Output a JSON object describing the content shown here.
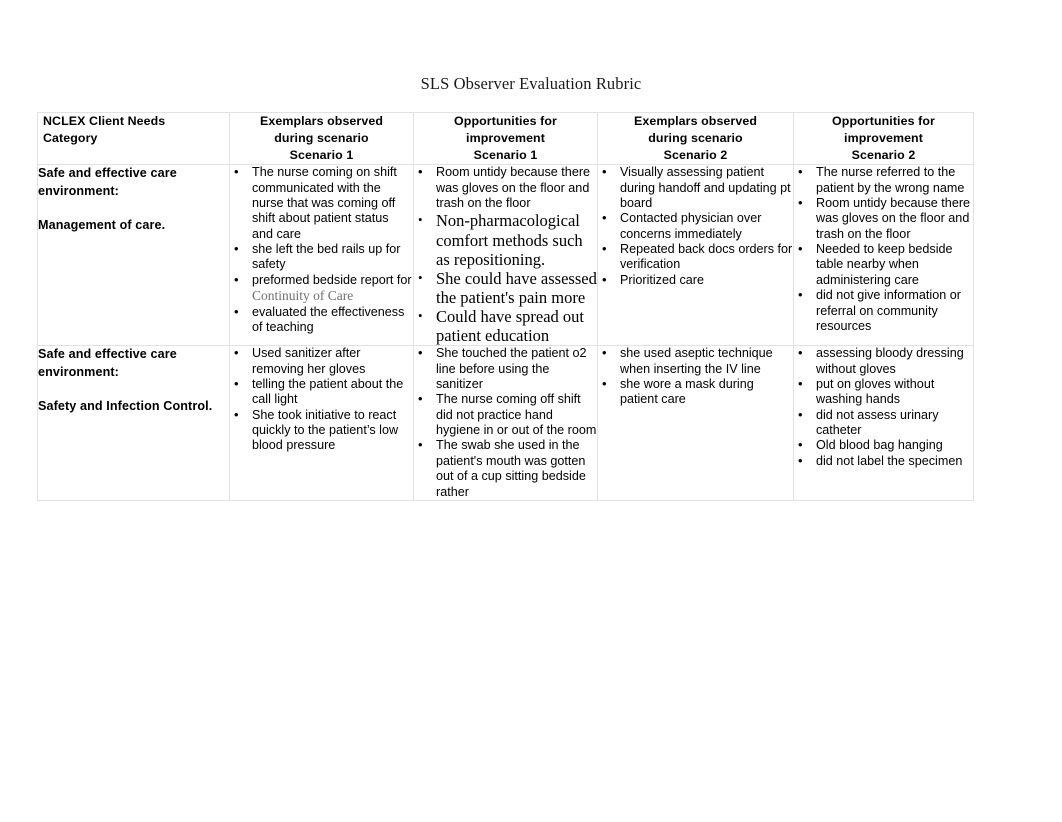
{
  "document": {
    "title": "SLS Observer Evaluation Rubric"
  },
  "table": {
    "headers": [
      "NCLEX Client Needs Category",
      "Exemplars observed during scenario Scenario 1",
      "Opportunities for improvement Scenario 1",
      "Exemplars observed during scenario Scenario 2",
      "Opportunities for improvement Scenario 2"
    ],
    "headers_lines": {
      "col1": [
        "NCLEX Client Needs",
        "Category"
      ],
      "col2": [
        "Exemplars observed",
        "during scenario",
        "Scenario 1"
      ],
      "col3": [
        "Opportunities for",
        "improvement",
        "Scenario 1"
      ],
      "col4": [
        "Exemplars observed",
        "during scenario",
        "Scenario 2"
      ],
      "col5": [
        "Opportunities for",
        "improvement",
        "Scenario 2"
      ]
    },
    "rows": [
      {
        "category": {
          "line1": "Safe and effective care environment:",
          "line2": "Management of care."
        },
        "exemplars_s1": [
          "The nurse coming on shift communicated with the nurse that was coming off shift about patient status and care",
          "she left the bed rails up for safety",
          "preformed bedside report for Continuity of Care",
          "evaluated the effectiveness of teaching"
        ],
        "exemplars_s1_parts": {
          "bullet3_plain": "preformed bedside report for ",
          "bullet3_emphasis": "Continuity of Care"
        },
        "opportunities_s1": [
          "Room untidy because there was gloves on the floor and trash on the floor",
          "Non-pharmacological comfort methods such as repositioning.",
          "She could have assessed the patient's pain more",
          "Could have spread out patient education"
        ],
        "exemplars_s2": [
          "Visually assessing patient during handoff and updating pt board",
          "Contacted physician over concerns immediately",
          "Repeated back docs orders for verification",
          "Prioritized care"
        ],
        "opportunities_s2": [
          "The nurse referred to the patient by the wrong name",
          "Room untidy because there was gloves on the floor and trash on the floor",
          "Needed to keep bedside table nearby when administering care",
          "did not give information or referral on community resources"
        ]
      },
      {
        "category": {
          "line1": "Safe and effective care environment:",
          "line2": "Safety and Infection Control."
        },
        "exemplars_s1": [
          "Used sanitizer after removing her gloves",
          "telling the patient about the call light",
          "She took initiative to react quickly to the patient’s low blood pressure"
        ],
        "opportunities_s1": [
          "She touched the patient o2 line before using the sanitizer",
          "The nurse coming off shift did not practice hand hygiene in or out of the room",
          "The swab she used in the patient's mouth was gotten out of a cup sitting bedside rather"
        ],
        "exemplars_s2": [
          "she used aseptic technique when inserting the IV line",
          "she wore a mask during patient care"
        ],
        "opportunities_s2": [
          "assessing bloody dressing without gloves",
          "put on gloves without washing hands",
          "did not assess urinary catheter",
          "Old blood bag hanging",
          "did not label the specimen"
        ]
      }
    ]
  },
  "colors": {
    "text": "#000000",
    "border": "#e2e2e2",
    "emphasis_serif": "#6f6f6f",
    "background": "#ffffff"
  }
}
